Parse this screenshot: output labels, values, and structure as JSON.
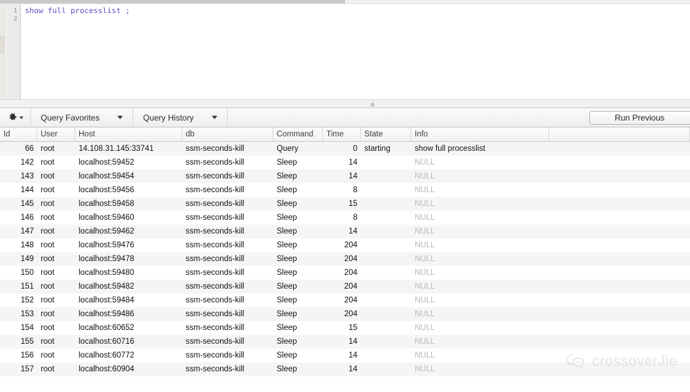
{
  "editor": {
    "line_numbers": [
      "1",
      "2"
    ],
    "code_keyword": "show full processlist",
    "code_punct": ";"
  },
  "toolbar": {
    "gear_icon": "gear-icon",
    "query_favorites": "Query Favorites",
    "query_history": "Query History",
    "run_previous": "Run Previous"
  },
  "grid": {
    "columns": [
      "Id",
      "User",
      "Host",
      "db",
      "Command",
      "Time",
      "State",
      "Info"
    ],
    "rows": [
      {
        "id": "66",
        "user": "root",
        "host": "14.108.31.145:33741",
        "db": "ssm-seconds-kill",
        "command": "Query",
        "time": "0",
        "state": "starting",
        "info": "show full processlist"
      },
      {
        "id": "142",
        "user": "root",
        "host": "localhost:59452",
        "db": "ssm-seconds-kill",
        "command": "Sleep",
        "time": "14",
        "state": "",
        "info": "NULL"
      },
      {
        "id": "143",
        "user": "root",
        "host": "localhost:59454",
        "db": "ssm-seconds-kill",
        "command": "Sleep",
        "time": "14",
        "state": "",
        "info": "NULL"
      },
      {
        "id": "144",
        "user": "root",
        "host": "localhost:59456",
        "db": "ssm-seconds-kill",
        "command": "Sleep",
        "time": "8",
        "state": "",
        "info": "NULL"
      },
      {
        "id": "145",
        "user": "root",
        "host": "localhost:59458",
        "db": "ssm-seconds-kill",
        "command": "Sleep",
        "time": "15",
        "state": "",
        "info": "NULL"
      },
      {
        "id": "146",
        "user": "root",
        "host": "localhost:59460",
        "db": "ssm-seconds-kill",
        "command": "Sleep",
        "time": "8",
        "state": "",
        "info": "NULL"
      },
      {
        "id": "147",
        "user": "root",
        "host": "localhost:59462",
        "db": "ssm-seconds-kill",
        "command": "Sleep",
        "time": "14",
        "state": "",
        "info": "NULL"
      },
      {
        "id": "148",
        "user": "root",
        "host": "localhost:59476",
        "db": "ssm-seconds-kill",
        "command": "Sleep",
        "time": "204",
        "state": "",
        "info": "NULL"
      },
      {
        "id": "149",
        "user": "root",
        "host": "localhost:59478",
        "db": "ssm-seconds-kill",
        "command": "Sleep",
        "time": "204",
        "state": "",
        "info": "NULL"
      },
      {
        "id": "150",
        "user": "root",
        "host": "localhost:59480",
        "db": "ssm-seconds-kill",
        "command": "Sleep",
        "time": "204",
        "state": "",
        "info": "NULL"
      },
      {
        "id": "151",
        "user": "root",
        "host": "localhost:59482",
        "db": "ssm-seconds-kill",
        "command": "Sleep",
        "time": "204",
        "state": "",
        "info": "NULL"
      },
      {
        "id": "152",
        "user": "root",
        "host": "localhost:59484",
        "db": "ssm-seconds-kill",
        "command": "Sleep",
        "time": "204",
        "state": "",
        "info": "NULL"
      },
      {
        "id": "153",
        "user": "root",
        "host": "localhost:59486",
        "db": "ssm-seconds-kill",
        "command": "Sleep",
        "time": "204",
        "state": "",
        "info": "NULL"
      },
      {
        "id": "154",
        "user": "root",
        "host": "localhost:60652",
        "db": "ssm-seconds-kill",
        "command": "Sleep",
        "time": "15",
        "state": "",
        "info": "NULL"
      },
      {
        "id": "155",
        "user": "root",
        "host": "localhost:60716",
        "db": "ssm-seconds-kill",
        "command": "Sleep",
        "time": "14",
        "state": "",
        "info": "NULL"
      },
      {
        "id": "156",
        "user": "root",
        "host": "localhost:60772",
        "db": "ssm-seconds-kill",
        "command": "Sleep",
        "time": "14",
        "state": "",
        "info": "NULL"
      },
      {
        "id": "157",
        "user": "root",
        "host": "localhost:60904",
        "db": "ssm-seconds-kill",
        "command": "Sleep",
        "time": "14",
        "state": "",
        "info": "NULL"
      }
    ]
  },
  "watermark": {
    "icon": "wechat-icon",
    "text": "crossoverJie"
  },
  "colors": {
    "sql_keyword": "#5a52c4",
    "null_text": "#b9b9b9",
    "row_stripe": "#f5f5f5",
    "watermark": "#cfcfcf"
  }
}
